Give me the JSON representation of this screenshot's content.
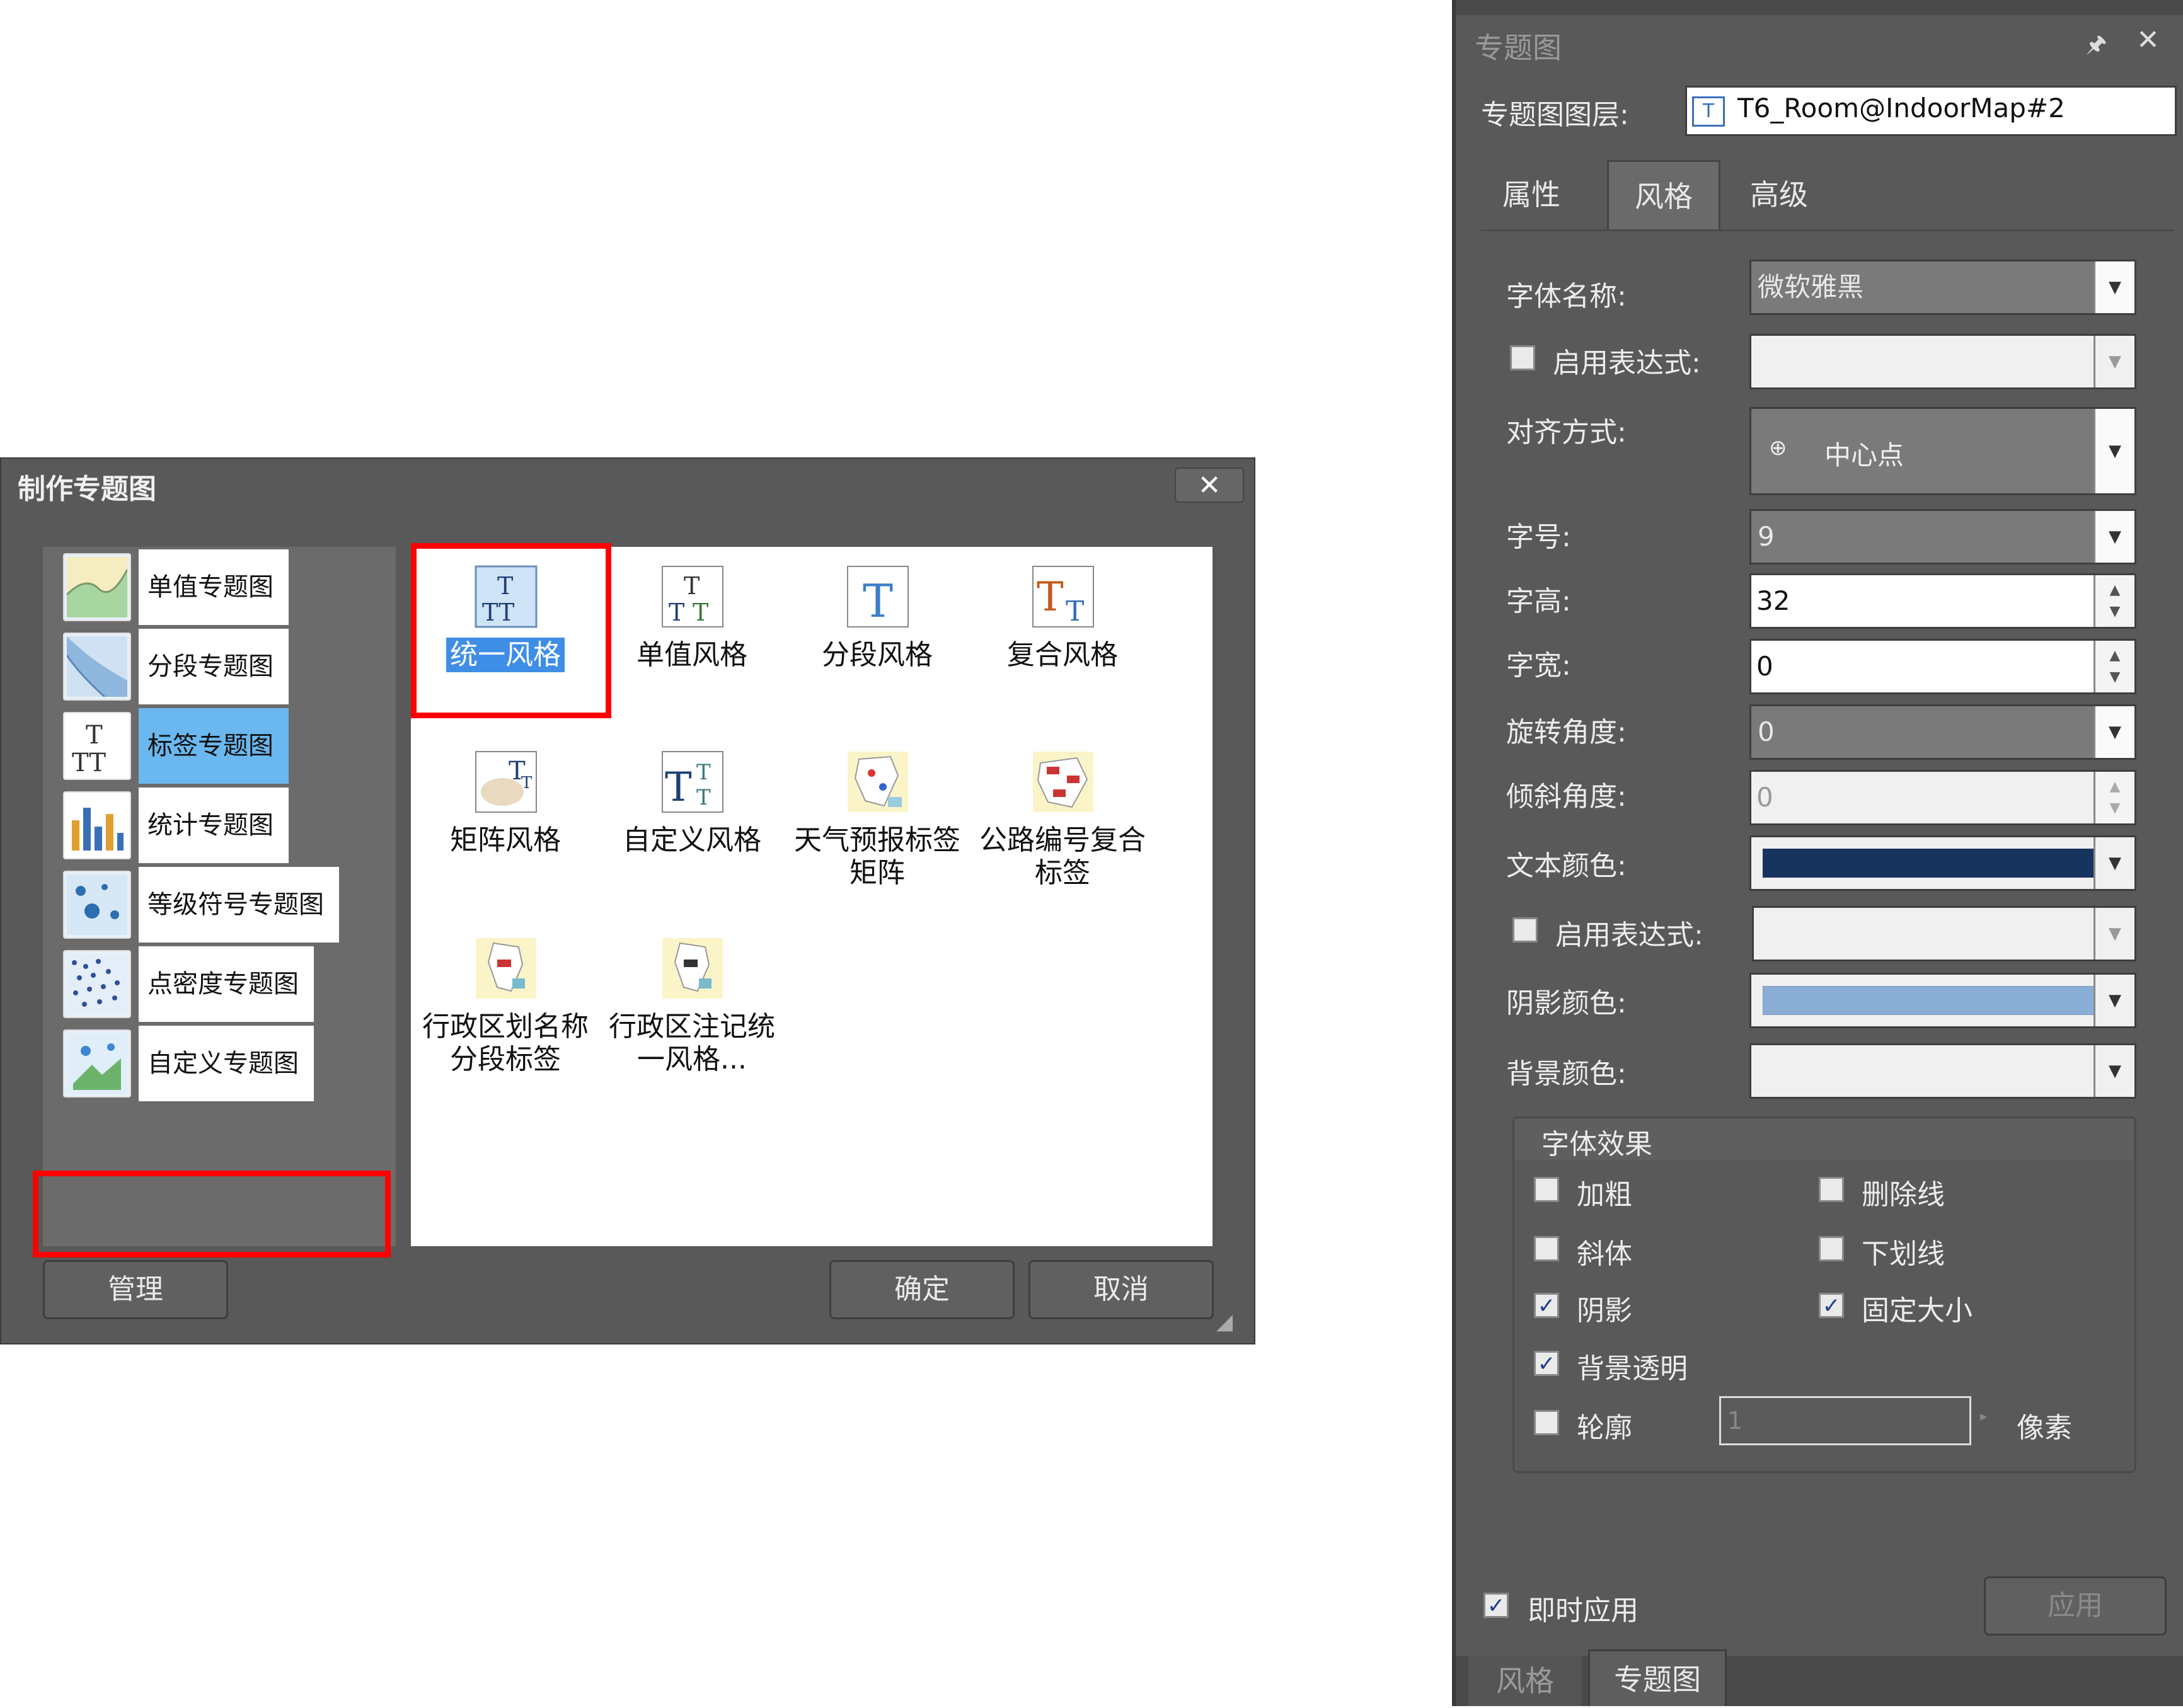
{
  "dialog": {
    "title": "制作专题图",
    "close": "✕",
    "categories": [
      {
        "label": "单值专题图",
        "icon": "unique-value-map-icon"
      },
      {
        "label": "分段专题图",
        "icon": "range-map-icon"
      },
      {
        "label": "标签专题图",
        "icon": "label-map-icon",
        "selected": true
      },
      {
        "label": "统计专题图",
        "icon": "graph-map-icon"
      },
      {
        "label": "等级符号专题图",
        "icon": "graduated-symbol-map-icon"
      },
      {
        "label": "点密度专题图",
        "icon": "dot-density-map-icon"
      },
      {
        "label": "自定义专题图",
        "icon": "custom-map-icon"
      }
    ],
    "styles": [
      {
        "label": "统一风格",
        "icon": "uniform-style-icon",
        "selected": true
      },
      {
        "label": "单值风格",
        "icon": "unique-value-style-icon"
      },
      {
        "label": "分段风格",
        "icon": "range-style-icon"
      },
      {
        "label": "复合风格",
        "icon": "composite-style-icon"
      },
      {
        "label": "矩阵风格",
        "icon": "matrix-style-icon"
      },
      {
        "label": "自定义风格",
        "icon": "custom-style-icon"
      },
      {
        "label": "天气预报标签矩阵",
        "icon": "weather-label-matrix-icon"
      },
      {
        "label": "公路编号复合标签",
        "icon": "highway-composite-label-icon"
      },
      {
        "label": "行政区划名称分段标签",
        "icon": "admin-region-range-label-icon"
      },
      {
        "label": "行政区注记统一风格...",
        "icon": "admin-region-uniform-label-icon"
      }
    ],
    "buttons": {
      "manage": "管理",
      "ok": "确定",
      "cancel": "取消"
    }
  },
  "panel": {
    "title": "专题图",
    "pin": "🖈",
    "close": "✕",
    "layer_label": "专题图图层:",
    "layer_value": "T6_Room@IndoorMap#2",
    "tabs": [
      "属性",
      "风格",
      "高级"
    ],
    "active_tab": "风格",
    "fields": {
      "font_name_label": "字体名称:",
      "font_name_value": "微软雅黑",
      "enable_expr_label": "启用表达式:",
      "align_label": "对齐方式:",
      "align_value": "中心点",
      "font_size_label": "字号:",
      "font_size_value": "9",
      "char_height_label": "字高:",
      "char_height_value": "32",
      "char_width_label": "字宽:",
      "char_width_value": "0",
      "rotation_label": "旋转角度:",
      "rotation_value": "0",
      "skew_label": "倾斜角度:",
      "skew_value": "0",
      "text_color_label": "文本颜色:",
      "text_color": "#17345e",
      "enable_expr2_label": "启用表达式:",
      "shadow_color_label": "阴影颜色:",
      "shadow_color": "#8aaed6",
      "bg_color_label": "背景颜色:"
    },
    "effects": {
      "title": "字体效果",
      "bold": "加粗",
      "strike": "删除线",
      "italic": "斜体",
      "underline": "下划线",
      "shadow": "阴影",
      "fixed_size": "固定大小",
      "bg_transparent": "背景透明",
      "outline": "轮廓",
      "outline_value": "1",
      "outline_unit": "像素"
    },
    "checks": {
      "bold": false,
      "strike": false,
      "italic": false,
      "underline": false,
      "shadow": true,
      "fixed_size": true,
      "bg_transparent": true,
      "outline": false,
      "enable_expr": false,
      "enable_expr2": false,
      "instant_apply": true
    },
    "instant_apply": "即时应用",
    "apply": "应用",
    "bottom_tabs": [
      "风格",
      "专题图"
    ]
  }
}
